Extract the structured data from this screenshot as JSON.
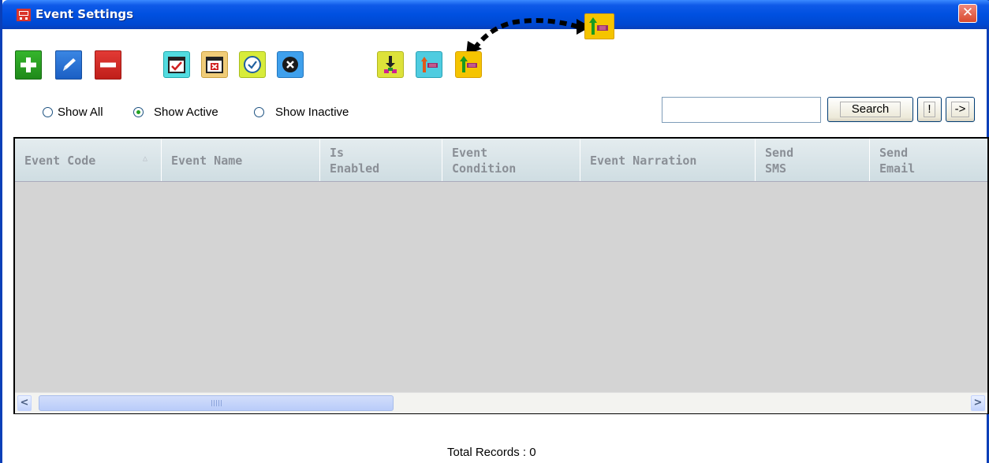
{
  "window": {
    "title": "Event Settings",
    "close_label": "✕"
  },
  "toolbar": {
    "buttons": [
      {
        "name": "add",
        "icon": "plus-icon"
      },
      {
        "name": "edit",
        "icon": "pencil-icon"
      },
      {
        "name": "delete",
        "icon": "minus-icon"
      },
      {
        "name": "calendar-check",
        "icon": "calendar-check-icon"
      },
      {
        "name": "calendar-remove",
        "icon": "calendar-x-icon"
      },
      {
        "name": "activate",
        "icon": "check-circle-icon"
      },
      {
        "name": "deactivate",
        "icon": "x-circle-icon"
      },
      {
        "name": "import",
        "icon": "download-arrow-icon"
      },
      {
        "name": "export-left",
        "icon": "export-icon"
      },
      {
        "name": "export-up",
        "icon": "export-up-icon"
      }
    ]
  },
  "filters": {
    "options": [
      {
        "label": "Show All",
        "selected": false
      },
      {
        "label": "Show Active",
        "selected": true
      },
      {
        "label": "Show Inactive",
        "selected": false
      }
    ]
  },
  "search": {
    "value": "",
    "placeholder": "",
    "button_label": "Search",
    "bang_label": "!",
    "arrow_label": "->"
  },
  "grid": {
    "columns": [
      {
        "line1": "Event Code",
        "line2": "",
        "sorted": "asc"
      },
      {
        "line1": "Event Name",
        "line2": ""
      },
      {
        "line1": "Is",
        "line2": "Enabled"
      },
      {
        "line1": "Event",
        "line2": "Condition"
      },
      {
        "line1": "Event Narration",
        "line2": ""
      },
      {
        "line1": "Send",
        "line2": "SMS"
      },
      {
        "line1": "Send",
        "line2": "Email"
      }
    ],
    "rows": [],
    "sort_indicator": "△",
    "scroll_left": "<",
    "scroll_right": ">"
  },
  "footer": {
    "total_records": "Total Records : 0"
  },
  "colors": {
    "titlebar": "#0050e0",
    "grid_body": "#d4d4d4",
    "header_text": "#8a8f96",
    "radio_selected": "#21a121"
  }
}
